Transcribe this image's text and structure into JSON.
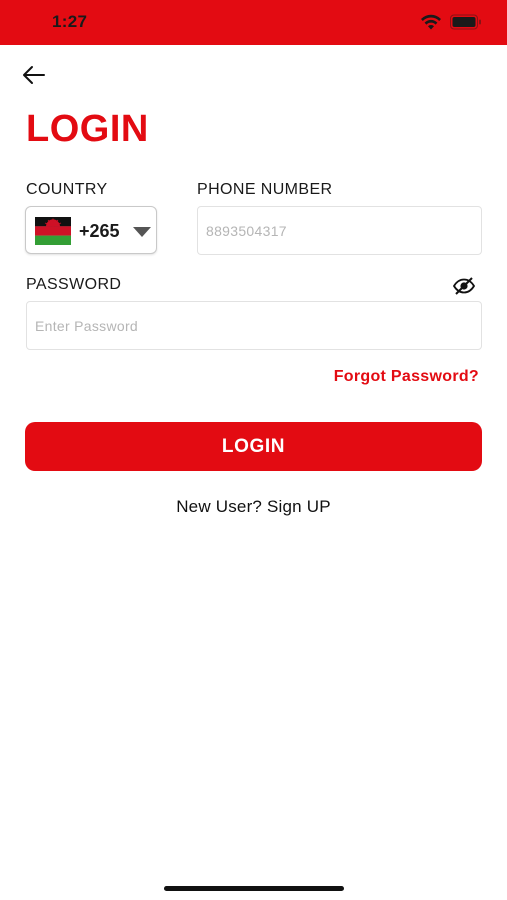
{
  "status_bar": {
    "time": "1:27",
    "background_color": "#e30b12",
    "icons": [
      "wifi-icon",
      "battery-icon"
    ]
  },
  "header": {
    "back_icon": "arrow-left-icon",
    "title": "LOGIN"
  },
  "form": {
    "country": {
      "label": "COUNTRY",
      "code": "+265",
      "flag_icon": "malawi-flag-icon",
      "dropdown_icon": "caret-down-icon"
    },
    "phone": {
      "label": "PHONE NUMBER",
      "value": "",
      "placeholder": "8893504317"
    },
    "password": {
      "label": "PASSWORD",
      "value": "",
      "placeholder": "Enter Password",
      "toggle_icon": "eye-slash-icon"
    },
    "forgot_password_label": "Forgot Password?",
    "submit_label": "LOGIN",
    "signup_label": "New User? Sign UP"
  },
  "colors": {
    "accent": "#e30b12",
    "text": "#111111",
    "placeholder": "#b5b5b5"
  }
}
